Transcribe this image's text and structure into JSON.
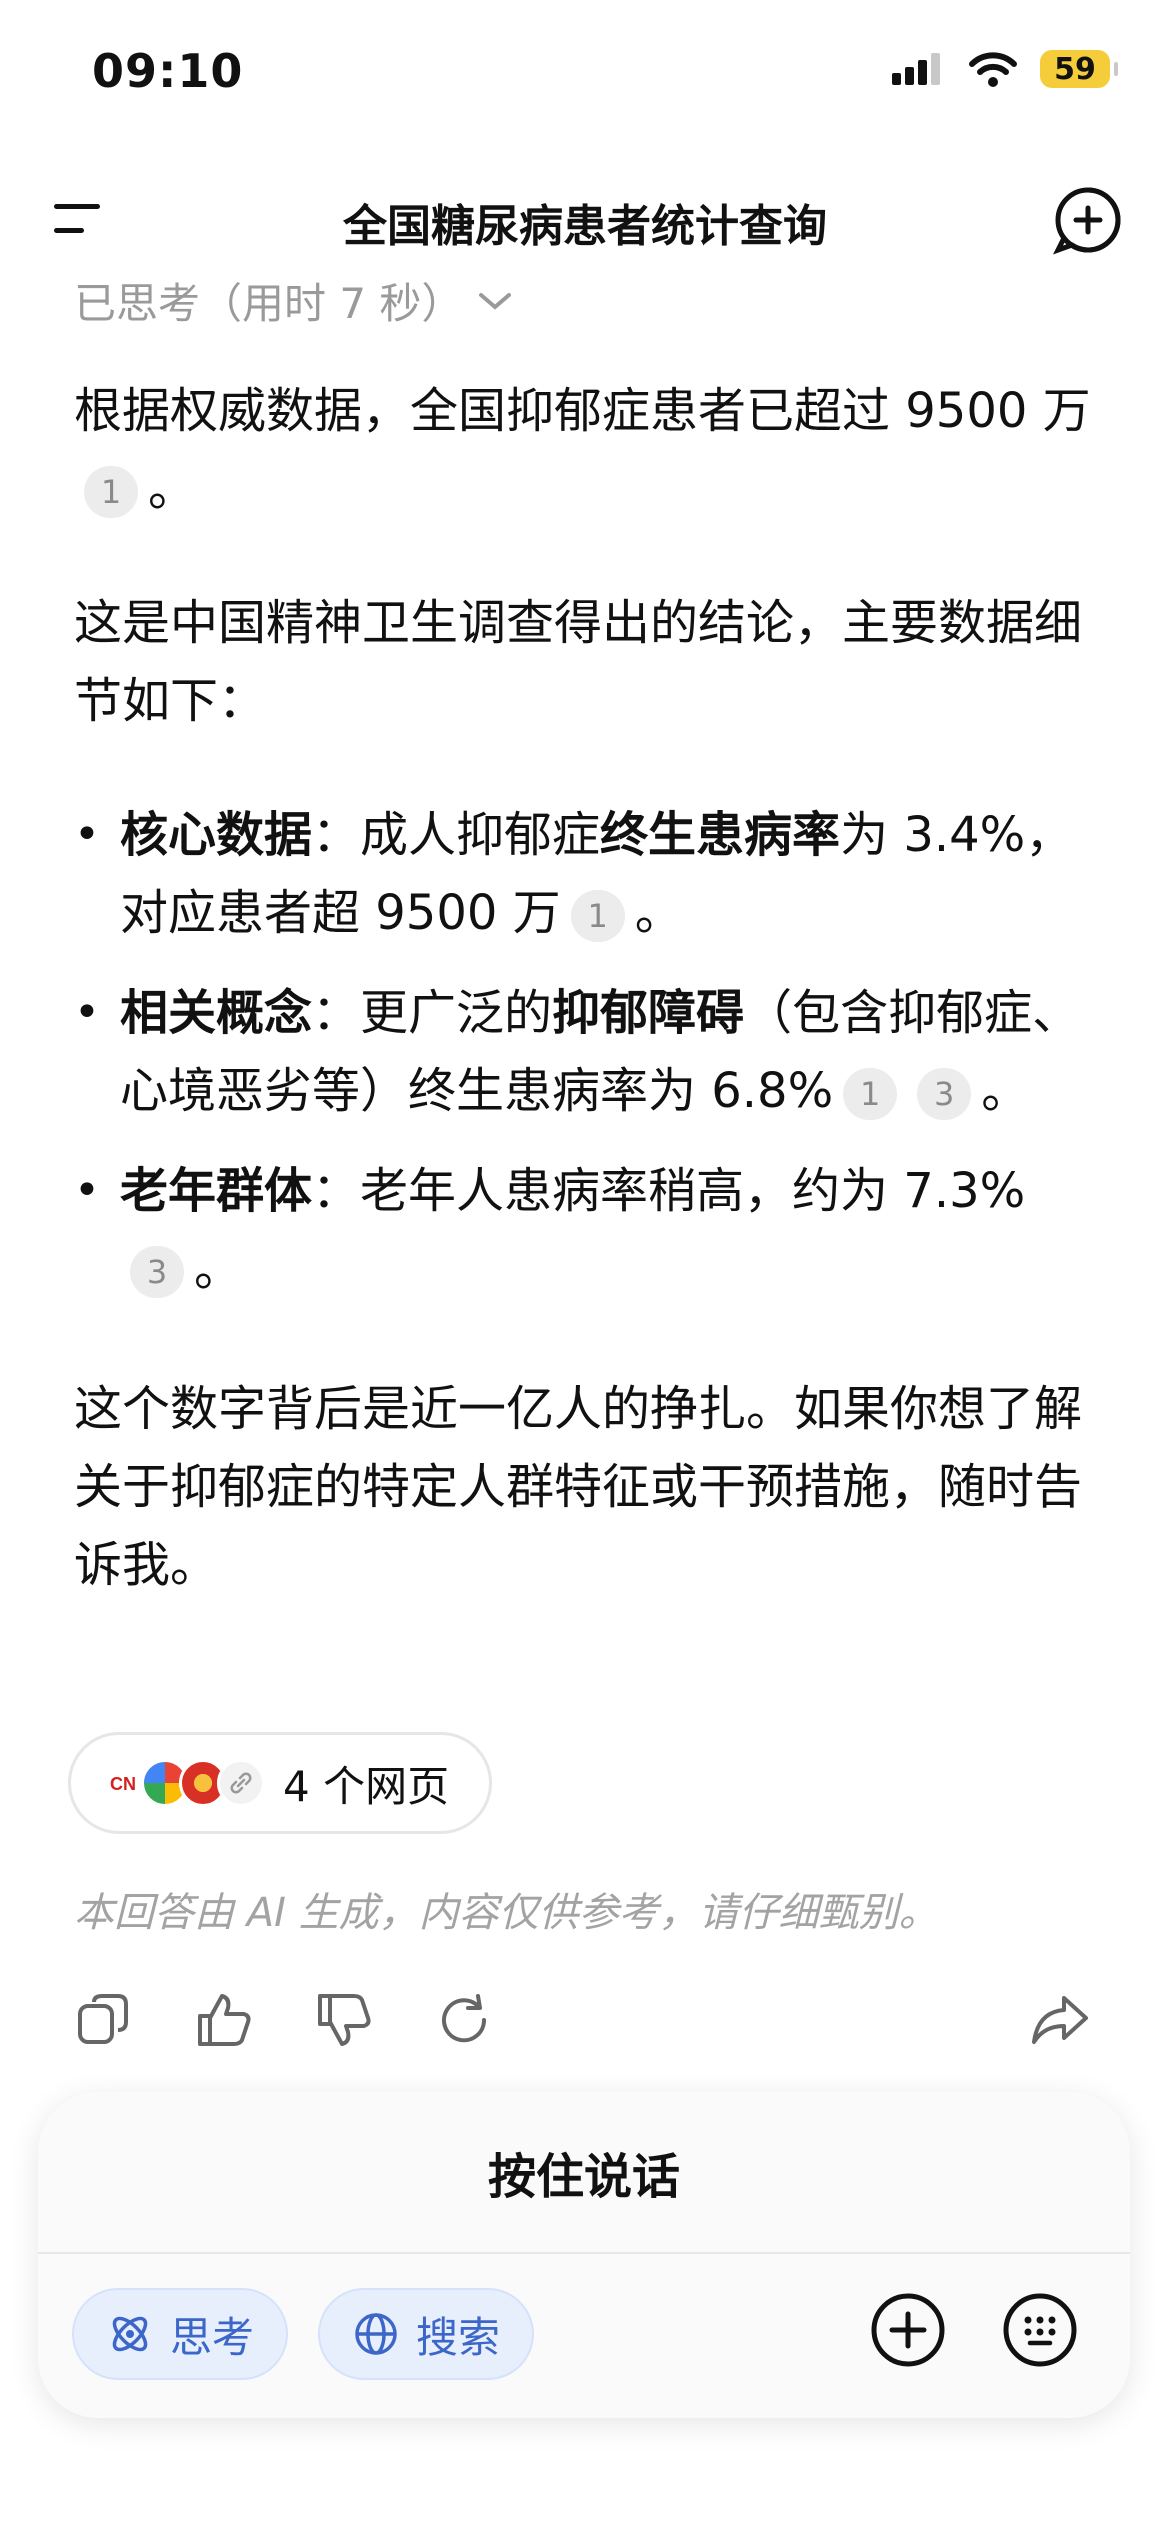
{
  "status_bar": {
    "time": "09:10",
    "battery": "59"
  },
  "header": {
    "title": "全国糖尿病患者统计查询"
  },
  "thinking": {
    "label": "已思考（用时 7 秒）"
  },
  "content": {
    "p1_text": "根据权威数据，全国抑郁症患者已超过 9500 万",
    "p1_ref": "1",
    "p1_end": "。",
    "p2_text": "这是中国精神卫生调查得出的结论，主要数据细节如下：",
    "bullets": [
      {
        "title": "核心数据",
        "sep": "：",
        "text_a": "成人抑郁症",
        "bold_a": "终生患病率",
        "text_b": "为 3.4%，对应患者超 9500 万",
        "refs": [
          "1"
        ],
        "end": "。"
      },
      {
        "title": "相关概念",
        "sep": "：",
        "text_a": "更广泛的",
        "bold_a": "抑郁障碍",
        "text_b": "（包含抑郁症、心境恶劣等）终生患病率为 6.8%",
        "refs": [
          "1",
          "3"
        ],
        "end": "。"
      },
      {
        "title": "老年群体",
        "sep": "：",
        "text_a": "老年人患病率稍高，约为 7.3%",
        "bold_a": "",
        "text_b": "",
        "refs": [
          "3"
        ],
        "end": "。"
      }
    ],
    "p3_text": "这个数字背后是近一亿人的挣扎。如果你想了解关于抑郁症的特定人群特征或干预措施，随时告诉我。"
  },
  "sources": {
    "label": "4 个网页",
    "icons": [
      "cn-icon",
      "multicolor-logo-icon",
      "emblem-icon",
      "link-icon"
    ]
  },
  "disclaimer": "本回答由 AI 生成，内容仅供参考，请仔细甄别。",
  "actions": [
    "copy-icon",
    "thumbs-up-icon",
    "thumbs-down-icon",
    "regenerate-icon",
    "share-icon"
  ],
  "composer": {
    "hold_to_talk": "按住说话",
    "think_chip": "思考",
    "search_chip": "搜索"
  },
  "colors": {
    "chip_text": "#3c66c8",
    "chip_bg": "#e7effd",
    "battery": "#f5cd3a"
  }
}
